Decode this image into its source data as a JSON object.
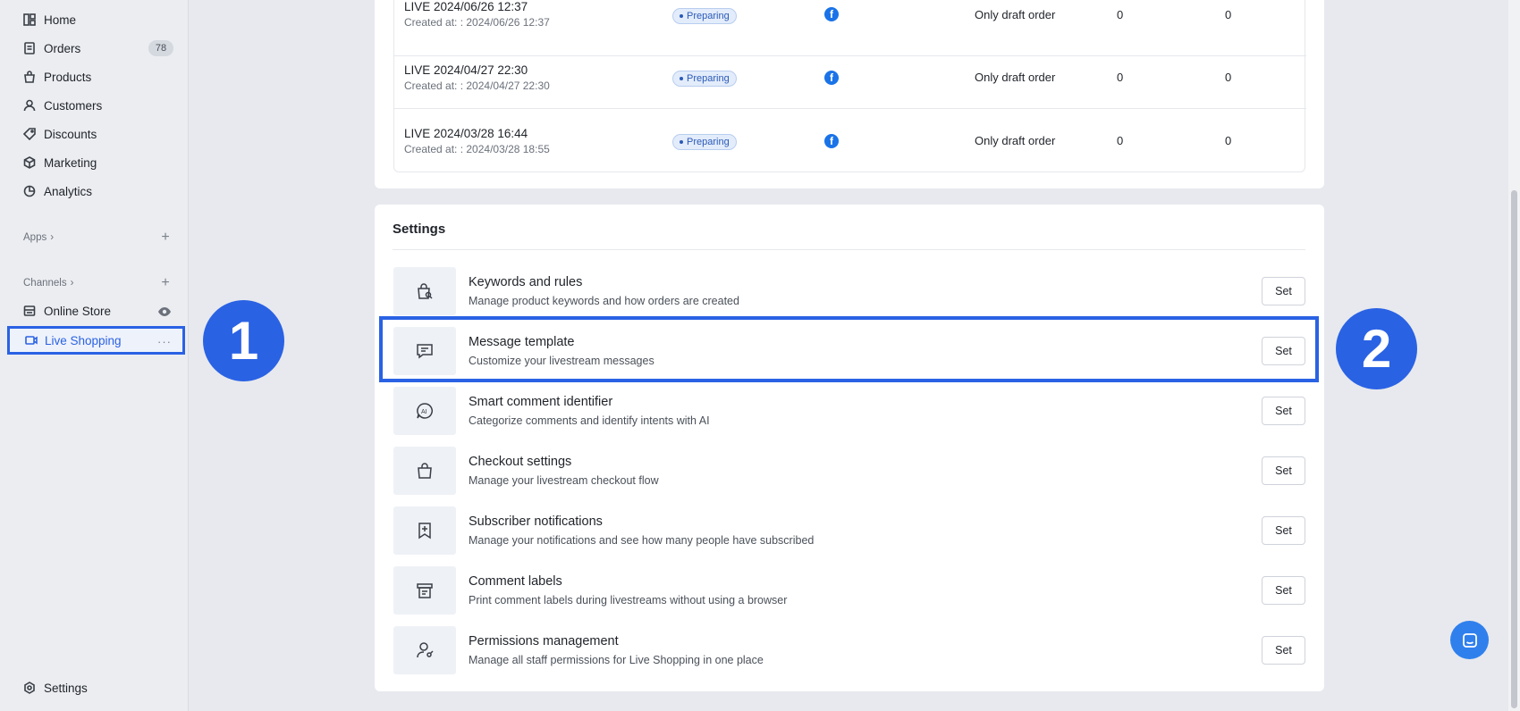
{
  "sidebar": {
    "nav": [
      {
        "label": "Home",
        "icon": "home-icon"
      },
      {
        "label": "Orders",
        "icon": "orders-icon",
        "badge": "78"
      },
      {
        "label": "Products",
        "icon": "bag-icon"
      },
      {
        "label": "Customers",
        "icon": "person-icon"
      },
      {
        "label": "Discounts",
        "icon": "tag-icon"
      },
      {
        "label": "Marketing",
        "icon": "cube-icon"
      },
      {
        "label": "Analytics",
        "icon": "pie-icon"
      }
    ],
    "apps_label": "Apps",
    "channels_label": "Channels",
    "channels": [
      {
        "label": "Online Store",
        "icon": "store-icon"
      },
      {
        "label": "Live Shopping",
        "icon": "video-icon"
      }
    ],
    "settings_label": "Settings"
  },
  "markers": {
    "one": "1",
    "two": "2"
  },
  "orders": [
    {
      "title": "LIVE 2024/06/26 12:37",
      "created": "Created at: : 2024/06/26 12:37",
      "status": "Preparing",
      "type": "Only draft order",
      "n1": "0",
      "n2": "0"
    },
    {
      "title": "LIVE 2024/04/27 22:30",
      "created": "Created at: : 2024/04/27 22:30",
      "status": "Preparing",
      "type": "Only draft order",
      "n1": "0",
      "n2": "0"
    },
    {
      "title": "LIVE 2024/03/28 16:44",
      "created": "Created at: : 2024/03/28 18:55",
      "status": "Preparing",
      "type": "Only draft order",
      "n1": "0",
      "n2": "0"
    }
  ],
  "settings": {
    "title": "Settings",
    "set_label": "Set",
    "items": [
      {
        "title": "Keywords and rules",
        "desc": "Manage product keywords and how orders are created",
        "icon": "bag-search-icon"
      },
      {
        "title": "Message template",
        "desc": "Customize your livestream messages",
        "icon": "message-icon"
      },
      {
        "title": "Smart comment identifier",
        "desc": "Categorize comments and identify intents with AI",
        "icon": "ai-chat-icon"
      },
      {
        "title": "Checkout settings",
        "desc": "Manage your livestream checkout flow",
        "icon": "shopping-bag-icon"
      },
      {
        "title": "Subscriber notifications",
        "desc": "Manage your notifications and see how many people have subscribed",
        "icon": "bookmark-plus-icon"
      },
      {
        "title": "Comment labels",
        "desc": "Print comment labels during livestreams without using a browser",
        "icon": "printer-icon"
      },
      {
        "title": "Permissions management",
        "desc": "Manage all staff permissions for Live Shopping in one place",
        "icon": "user-key-icon"
      }
    ]
  },
  "colors": {
    "accent": "#2a62e4",
    "facebook": "#1a73e8"
  }
}
